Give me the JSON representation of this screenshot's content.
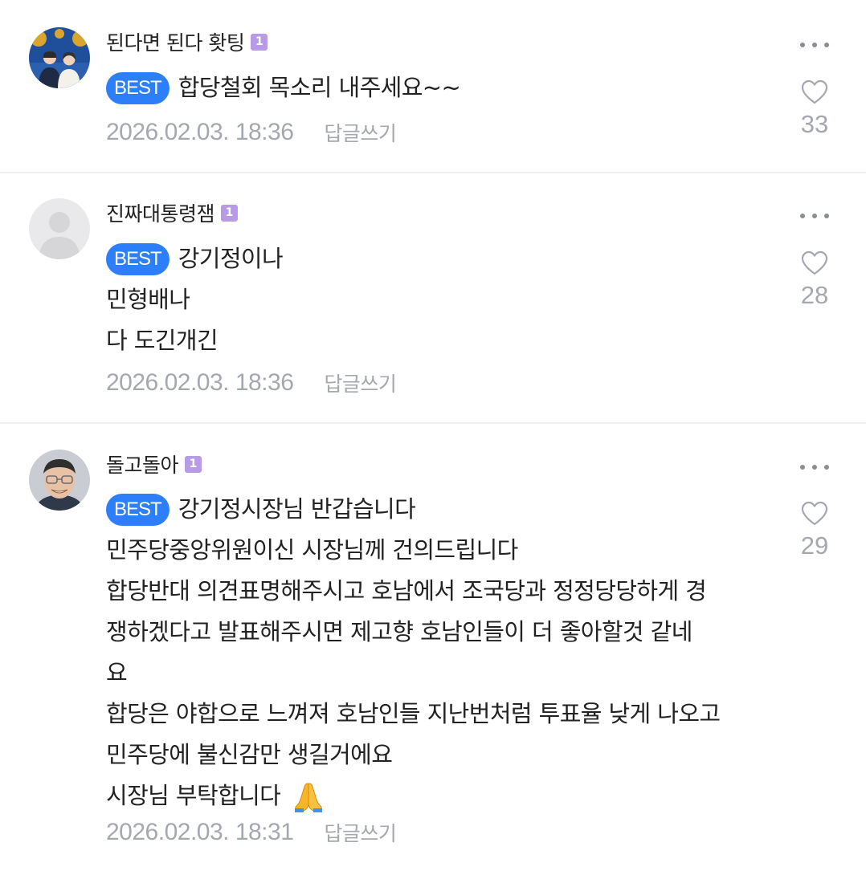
{
  "comments": [
    {
      "author": "된다면 된다 홧팅",
      "level": "1",
      "badge": "BEST",
      "lines": [
        "합당철회 목소리 내주세요~~"
      ],
      "emoji": "",
      "timestamp": "2026.02.03. 18:36",
      "reply_label": "답글쓰기",
      "likes": "33",
      "avatar_icon": "couple-photo-avatar"
    },
    {
      "author": "진짜대통령잼",
      "level": "1",
      "badge": "BEST",
      "lines": [
        "강기정이나",
        "민형배나",
        "다 도긴개긴"
      ],
      "emoji": "",
      "timestamp": "2026.02.03. 18:36",
      "reply_label": "답글쓰기",
      "likes": "28",
      "avatar_icon": "default-user-avatar"
    },
    {
      "author": "돌고돌아",
      "level": "1",
      "badge": "BEST",
      "lines": [
        "강기정시장님 반갑습니다",
        "민주당중앙위원이신 시장님께 건의드립니다",
        "합당반대 의견표명해주시고 호남에서 조국당과 정정당당하게 경",
        "쟁하겠다고 발표해주시면 제고향 호남인들이 더 좋아할것 같네",
        "요",
        "합당은 야합으로 느껴져 호남인들 지난번처럼 투표율 낮게 나오고",
        "민주당에 불신감만 생길거에요",
        "시장님 부탁합니다"
      ],
      "emoji": "folded-hands-icon",
      "timestamp": "2026.02.03. 18:31",
      "reply_label": "답글쓰기",
      "likes": "29",
      "avatar_icon": "man-glasses-photo-avatar"
    }
  ],
  "colors": {
    "best_badge": "#2d7ff9",
    "level_badge": "#b89be6",
    "meta_text": "#a5a8ae",
    "body_text": "#222222",
    "divider": "#eeeff2"
  }
}
